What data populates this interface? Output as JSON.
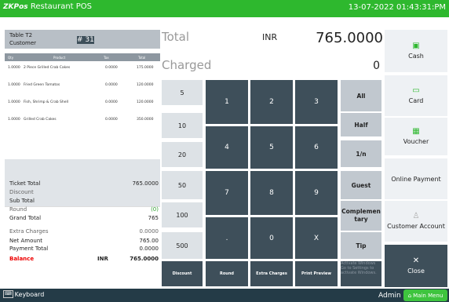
{
  "header": {
    "brand_prefix": "ZK",
    "brand_pos": "Pos",
    "title": "Restaurant POS",
    "datetime": "13-07-2022 01:43:31:PM"
  },
  "order": {
    "table": "Table T2",
    "customer": "Customer",
    "number": "# 31",
    "columns": {
      "qty": "Qty",
      "product": "Product",
      "tax": "Tax",
      "total": "Total"
    },
    "items": [
      {
        "qty": "1.0000",
        "name": "2 Piece Grilled Crab Cakes",
        "tax": "0.0000",
        "total": "175.0000"
      },
      {
        "qty": "1.0000",
        "name": "Fried Green Tomatos",
        "tax": "0.0000",
        "total": "120.0000"
      },
      {
        "qty": "1.0000",
        "name": "Fish, Shrimp & Crab Shell",
        "tax": "0.0000",
        "total": "120.0000"
      },
      {
        "qty": "1.0000",
        "name": "Grilled Crab Cakes",
        "tax": "0.0000",
        "total": "350.0000"
      }
    ]
  },
  "summary": {
    "ticket_total_label": "Ticket Total",
    "ticket_total": "765.0000",
    "discount_label": "Discount",
    "sub_total_label": "Sub Total",
    "round_label": "Round",
    "round": "(0)",
    "grand_total_label": "Grand Total",
    "grand_total": "765",
    "extra_charges_label": "Extra Charges",
    "extra_charges": "0.0000",
    "net_amount_label": "Net Amount",
    "net_amount": "765.00",
    "payment_total_label": "Payment Total",
    "payment_total": "0.0000",
    "balance_label": "Balance",
    "balance_currency": "INR",
    "balance": "765.0000"
  },
  "totals": {
    "total_label": "Total",
    "currency": "INR",
    "total_value": "765.0000",
    "charged_label": "Charged",
    "charged_value": "0"
  },
  "presets": [
    "5",
    "10",
    "20",
    "50",
    "100",
    "500"
  ],
  "keypad": [
    "1",
    "2",
    "3",
    "4",
    "5",
    "6",
    "7",
    "8",
    "9",
    ".",
    "0",
    "X"
  ],
  "functions": {
    "all": "All",
    "half": "Half",
    "fraction": "1/n",
    "guest": "Guest",
    "complementary": "Complemen tary",
    "tip": "Tip"
  },
  "bottom_buttons": {
    "discount": "Discount",
    "round": "Round",
    "extra_charges": "Extra Charges",
    "print_preview": "Print Preview"
  },
  "payments": {
    "cash": "Cash",
    "card": "Card",
    "voucher": "Voucher",
    "online": "Online Payment",
    "customer_account": "Customer Account",
    "close": "Close"
  },
  "overlay": {
    "line1": "Activate Windows",
    "line2": "Go to Settings to activate Windows."
  },
  "footer": {
    "keyboard": "Keyboard",
    "user": "Admin",
    "main_menu": "Main Menu"
  }
}
